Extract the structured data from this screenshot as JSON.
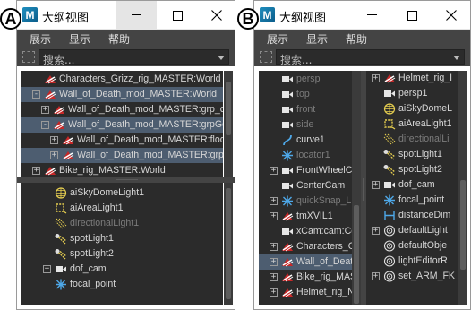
{
  "badges": {
    "a": "A",
    "b": "B"
  },
  "window": {
    "title": "大纲视图",
    "logo": "M",
    "menu": [
      "展示",
      "显示",
      "帮助"
    ],
    "search_placeholder": "搜索..."
  },
  "panel_a": {
    "top_items": [
      {
        "label": "Characters_Grizz_rig_MASTER:World",
        "icon": "transform-icon",
        "expand": "",
        "selected": false,
        "dim": false
      },
      {
        "label": "Wall_of_Death_mod_MASTER:World",
        "icon": "transform-icon",
        "expand": "-",
        "selected": true,
        "dim": false
      },
      {
        "label": "Wall_of_Death_mod_MASTER:grp_co",
        "icon": "transform-icon",
        "expand": "+",
        "selected": false,
        "dim": false
      },
      {
        "label": "Wall_of_Death_mod_MASTER:grpGeo",
        "icon": "transform-icon",
        "expand": "-",
        "selected": true,
        "dim": false
      },
      {
        "label": "Wall_of_Death_mod_MASTER:floor",
        "icon": "transform-icon",
        "expand": "+",
        "selected": false,
        "dim": false
      },
      {
        "label": "Wall_of_Death_mod_MASTER:grp_",
        "icon": "transform-icon",
        "expand": "+",
        "selected": true,
        "dim": false
      },
      {
        "label": "Bike_rig_MASTER:World",
        "icon": "transform-icon",
        "expand": "+",
        "selected": false,
        "dim": false
      }
    ],
    "bottom_items": [
      {
        "label": "aiSkyDomeLight1",
        "icon": "skydome-icon",
        "expand": "",
        "dim": false
      },
      {
        "label": "aiAreaLight1",
        "icon": "area-light-icon",
        "expand": "",
        "dim": false
      },
      {
        "label": "directionalLight1",
        "icon": "directional-light-icon",
        "expand": "",
        "dim": true
      },
      {
        "label": "spotLight1",
        "icon": "spot-light-icon",
        "expand": "",
        "dim": false
      },
      {
        "label": "spotLight2",
        "icon": "spot-light-icon",
        "expand": "",
        "dim": false
      },
      {
        "label": "dof_cam",
        "icon": "camera-icon",
        "expand": "+",
        "dim": false
      },
      {
        "label": "focal_point",
        "icon": "locator-icon",
        "expand": "",
        "dim": false
      }
    ]
  },
  "panel_b": {
    "left_items": [
      {
        "label": "persp",
        "icon": "camera-icon",
        "expand": "",
        "selected": false,
        "dim": true
      },
      {
        "label": "top",
        "icon": "camera-icon",
        "expand": "",
        "selected": false,
        "dim": true
      },
      {
        "label": "front",
        "icon": "camera-icon",
        "expand": "",
        "selected": false,
        "dim": true
      },
      {
        "label": "side",
        "icon": "camera-icon",
        "expand": "",
        "selected": false,
        "dim": true
      },
      {
        "label": "curve1",
        "icon": "curve-icon",
        "expand": "",
        "selected": false,
        "dim": false
      },
      {
        "label": "locator1",
        "icon": "locator-icon",
        "expand": "",
        "selected": false,
        "dim": true
      },
      {
        "label": "FrontWheelC",
        "icon": "camera-icon",
        "expand": "+",
        "selected": false,
        "dim": false
      },
      {
        "label": "CenterCam",
        "icon": "camera-icon",
        "expand": "",
        "selected": false,
        "dim": false
      },
      {
        "label": "quickSnap_L",
        "icon": "locator-icon",
        "expand": "+",
        "selected": false,
        "dim": true
      },
      {
        "label": "tmXVIL1",
        "icon": "transform-icon",
        "expand": "+",
        "selected": false,
        "dim": false
      },
      {
        "label": "xCam:cam:Co",
        "icon": "camera-icon",
        "expand": "",
        "selected": false,
        "dim": false
      },
      {
        "label": "Characters_G",
        "icon": "transform-icon",
        "expand": "+",
        "selected": false,
        "dim": false
      },
      {
        "label": "Wall_of_Deat",
        "icon": "transform-icon",
        "expand": "+",
        "selected": true,
        "dim": false
      },
      {
        "label": "Bike_rig_MAS",
        "icon": "transform-icon",
        "expand": "+",
        "selected": false,
        "dim": false
      },
      {
        "label": "Helmet_rig_N",
        "icon": "transform-icon",
        "expand": "+",
        "selected": false,
        "dim": false
      }
    ],
    "right_items": [
      {
        "label": "Helmet_rig_I",
        "icon": "transform-icon",
        "expand": "+",
        "dim": false
      },
      {
        "label": "persp1",
        "icon": "camera-icon",
        "expand": "",
        "dim": false
      },
      {
        "label": "aiSkyDomeL",
        "icon": "skydome-icon",
        "expand": "",
        "dim": false
      },
      {
        "label": "aiAreaLight1",
        "icon": "area-light-icon",
        "expand": "",
        "dim": false
      },
      {
        "label": "directionalLi",
        "icon": "directional-light-icon",
        "expand": "",
        "dim": true
      },
      {
        "label": "spotLight1",
        "icon": "spot-light-icon",
        "expand": "",
        "dim": false
      },
      {
        "label": "spotLight2",
        "icon": "spot-light-icon",
        "expand": "",
        "dim": false
      },
      {
        "label": "dof_cam",
        "icon": "camera-icon",
        "expand": "+",
        "dim": false
      },
      {
        "label": "focal_point",
        "icon": "locator-icon",
        "expand": "",
        "dim": false
      },
      {
        "label": "distanceDim",
        "icon": "distance-icon",
        "expand": "",
        "dim": false
      },
      {
        "label": "defaultLight",
        "icon": "set-icon",
        "expand": "+",
        "dim": false
      },
      {
        "label": "defaultObje",
        "icon": "set-icon",
        "expand": "",
        "dim": false
      },
      {
        "label": "lightEditorR",
        "icon": "set-icon",
        "expand": "",
        "dim": false
      },
      {
        "label": "set_ARM_FK",
        "icon": "set-icon",
        "expand": "+",
        "dim": false
      }
    ]
  },
  "colors": {
    "panel_bg": "#2b2b2b",
    "chrome_bg": "#444444",
    "selection": "#4d5d70",
    "text": "#d6d6d6",
    "dim_text": "#7c7c7c",
    "accent_blue": "#4ea8e8",
    "accent_yellow": "#e8d050"
  }
}
